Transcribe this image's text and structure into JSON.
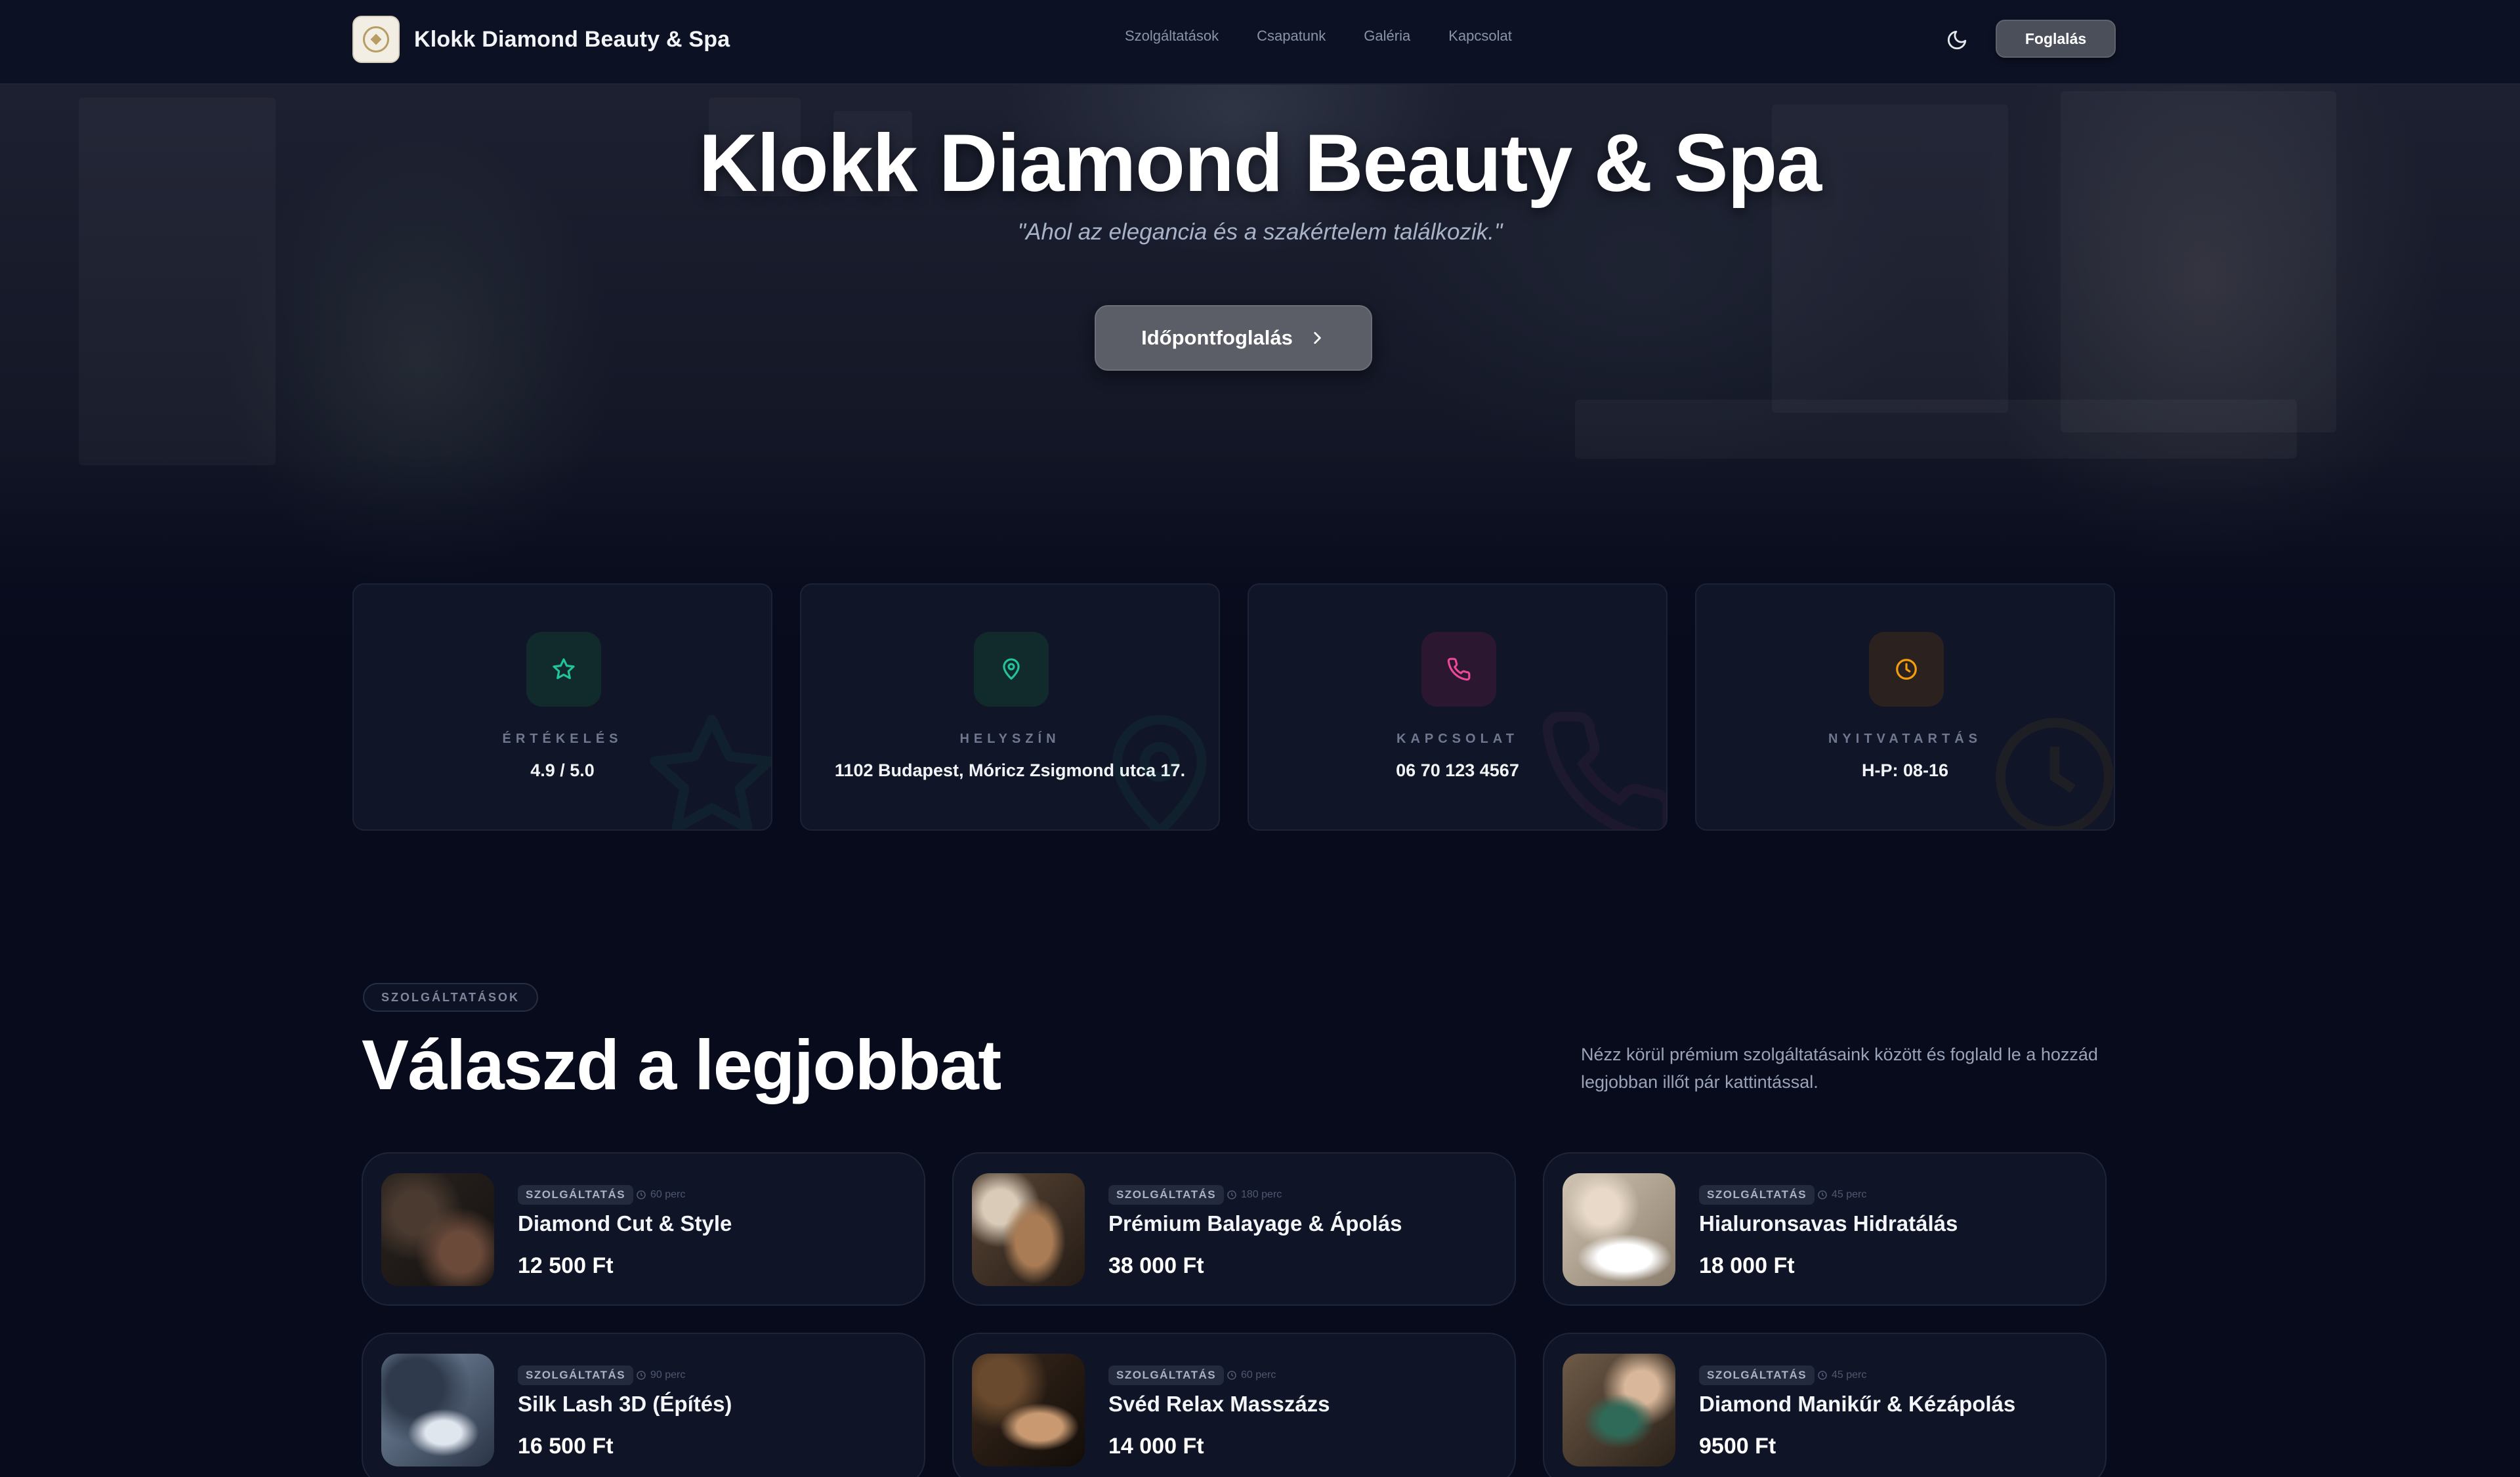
{
  "navbar": {
    "brand_name": "Klokk Diamond Beauty & Spa",
    "links": [
      "Szolgáltatások",
      "Csapatunk",
      "Galéria",
      "Kapcsolat"
    ],
    "book_label": "Foglalás"
  },
  "hero": {
    "title": "Klokk Diamond Beauty & Spa",
    "tagline": "\"Ahol az elegancia és a szakértelem találkozik.\"",
    "cta_label": "Időpontfoglalás"
  },
  "info_cards": [
    {
      "label": "ÉRTÉKELÉS",
      "value": "4.9 / 5.0",
      "icon": "star-icon",
      "color": "#22c39a",
      "bg": "#112a2c"
    },
    {
      "label": "HELYSZÍN",
      "value": "1102 Budapest, Móricz Zsigmond utca 17.",
      "icon": "map-pin-icon",
      "color": "#22c39a",
      "bg": "#112a2c"
    },
    {
      "label": "KAPCSOLAT",
      "value": "06 70 123 4567",
      "icon": "phone-icon",
      "color": "#ec4899",
      "bg": "#2c1730"
    },
    {
      "label": "NYITVATARTÁS",
      "value": "H-P: 08-16",
      "icon": "clock-icon",
      "color": "#f59e0b",
      "bg": "#2b2220"
    }
  ],
  "services_section": {
    "badge": "SZOLGÁLTATÁSOK",
    "title": "Válaszd a legjobbat",
    "description": "Nézz körül prémium szolgáltatásaink között és foglald le a hozzád legjobban illőt pár kattintással."
  },
  "services": [
    {
      "tag": "SZOLGÁLTATÁS",
      "duration": "60 perc",
      "name": "Diamond Cut & Style",
      "price": "12 500 Ft"
    },
    {
      "tag": "SZOLGÁLTATÁS",
      "duration": "180 perc",
      "name": "Prémium Balayage & Ápolás",
      "price": "38 000 Ft"
    },
    {
      "tag": "SZOLGÁLTATÁS",
      "duration": "45 perc",
      "name": "Hialuronsavas Hidratálás",
      "price": "18 000 Ft"
    },
    {
      "tag": "SZOLGÁLTATÁS",
      "duration": "90 perc",
      "name": "Silk Lash 3D (Építés)",
      "price": "16 500 Ft"
    },
    {
      "tag": "SZOLGÁLTATÁS",
      "duration": "60 perc",
      "name": "Svéd Relax Masszázs",
      "price": "14 000 Ft"
    },
    {
      "tag": "SZOLGÁLTATÁS",
      "duration": "45 perc",
      "name": "Diamond Manikűr & Kézápolás",
      "price": "9500 Ft"
    }
  ],
  "colors": {
    "background": "#070b1c",
    "card": "#101627",
    "button": "#5b5e66"
  }
}
